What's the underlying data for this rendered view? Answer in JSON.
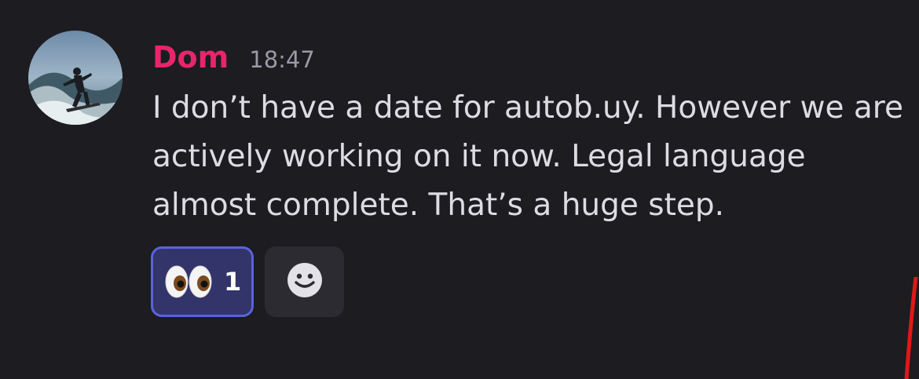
{
  "message": {
    "author": "Dom",
    "timestamp": "18:47",
    "text": "I don’t have a date for autob.uy. However we are actively working on it now. Legal language almost complete. That’s a huge step.",
    "author_color": "#e8256b"
  },
  "avatar": {
    "icon": "surfer-avatar"
  },
  "reactions": [
    {
      "emoji_name": "eyes-icon",
      "count": "1",
      "selected": true
    }
  ],
  "add_reaction": {
    "icon": "smiley-add-reaction-icon"
  }
}
